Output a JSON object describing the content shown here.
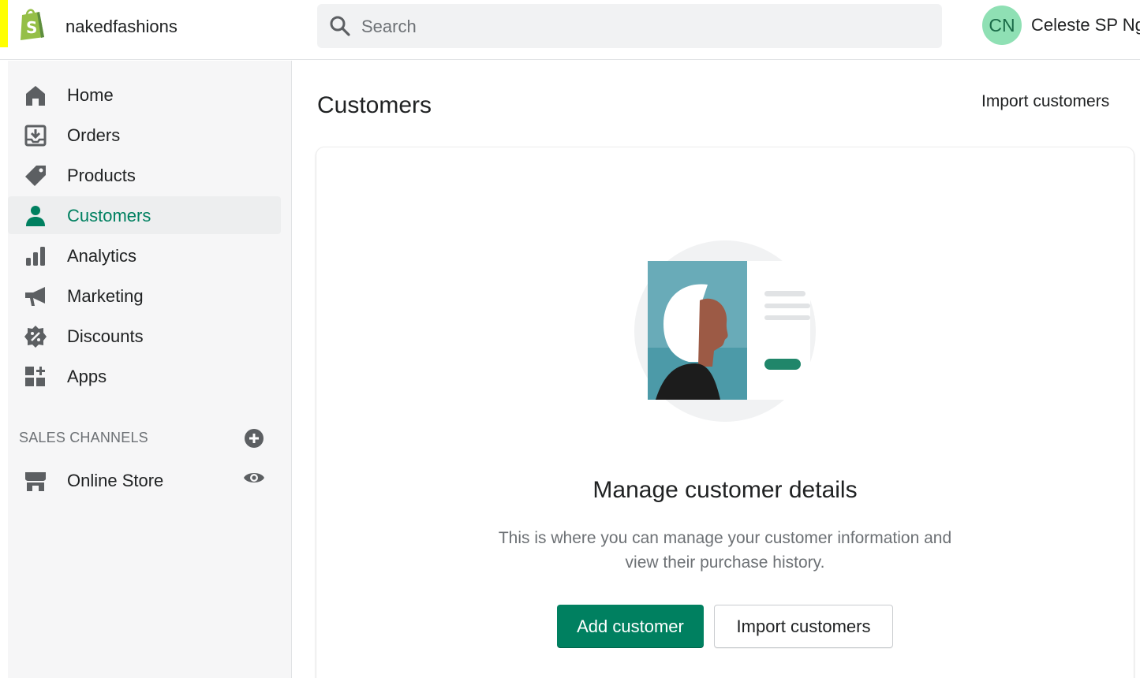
{
  "topbar": {
    "store_name": "nakedfashions",
    "search_placeholder": "Search",
    "user_initials": "CN",
    "user_name": "Celeste SP Ng"
  },
  "sidebar": {
    "items": [
      {
        "label": "Home",
        "icon": "home-icon"
      },
      {
        "label": "Orders",
        "icon": "orders-icon"
      },
      {
        "label": "Products",
        "icon": "tag-icon"
      },
      {
        "label": "Customers",
        "icon": "person-icon",
        "active": true
      },
      {
        "label": "Analytics",
        "icon": "bar-chart-icon"
      },
      {
        "label": "Marketing",
        "icon": "megaphone-icon"
      },
      {
        "label": "Discounts",
        "icon": "discount-icon"
      },
      {
        "label": "Apps",
        "icon": "apps-icon"
      }
    ],
    "sales_channels_title": "SALES CHANNELS",
    "channels": [
      {
        "label": "Online Store",
        "icon": "store-icon"
      }
    ]
  },
  "main": {
    "title": "Customers",
    "header_action": "Import customers",
    "empty_state": {
      "heading": "Manage customer details",
      "body": "This is where you can manage your customer information and view their purchase history.",
      "primary_action": "Add customer",
      "secondary_action": "Import customers"
    }
  },
  "colors": {
    "accent": "#008060",
    "avatar_bg": "#8fe0b4",
    "sidebar_bg": "#f6f6f7",
    "highlight_mark": "#ffff00"
  }
}
